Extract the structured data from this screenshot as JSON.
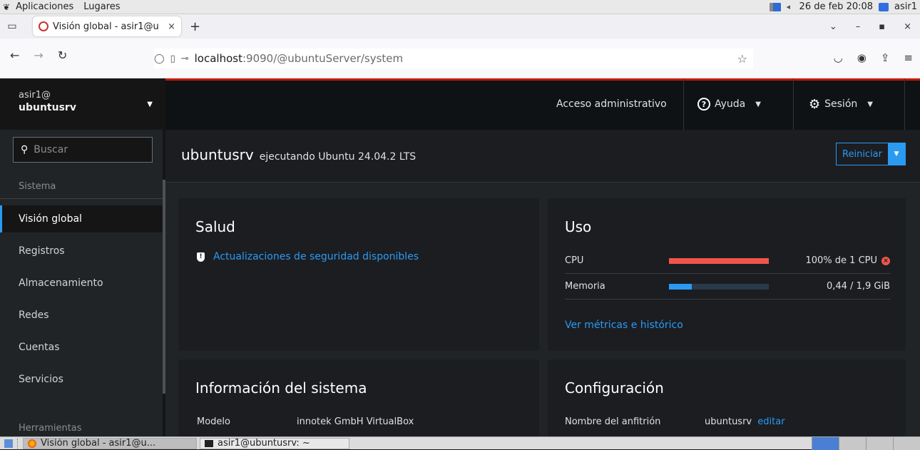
{
  "system_bar": {
    "apps_label": "Aplicaciones",
    "places_label": "Lugares",
    "clock": "26 de feb 20:08",
    "user": "asir1"
  },
  "browser": {
    "tab_title": "Visión global - asir1@u",
    "url_host": "localhost",
    "url_rest": ":9090/@ubuntuServer/system"
  },
  "cockpit": {
    "host_user": "asir1@",
    "host_name": "ubuntusrv",
    "header": {
      "admin_access": "Acceso administrativo",
      "help": "Ayuda",
      "session": "Sesión"
    },
    "sidebar": {
      "search_placeholder": "Buscar",
      "section_system": "Sistema",
      "section_tools": "Herramientas",
      "items": [
        "Visión global",
        "Registros",
        "Almacenamiento",
        "Redes",
        "Cuentas",
        "Servicios"
      ]
    },
    "page": {
      "hostname": "ubuntusrv",
      "os": "ejecutando Ubuntu 24.04.2 LTS",
      "restart": "Reiniciar"
    },
    "health": {
      "title": "Salud",
      "alert": "Actualizaciones de seguridad disponibles"
    },
    "usage": {
      "title": "Uso",
      "cpu_label": "CPU",
      "cpu_value": "100% de 1 CPU",
      "cpu_fraction": 1.0,
      "mem_label": "Memoria",
      "mem_value": "0,44 / 1,9 GiB",
      "mem_fraction": 0.23,
      "metrics_link": "Ver métricas e histórico"
    },
    "sysinfo": {
      "title": "Información del sistema",
      "model_label": "Modelo",
      "model_value": "innotek GmbH VirtualBox"
    },
    "config": {
      "title": "Configuración",
      "hostname_label": "Nombre del anfitrión",
      "hostname_value": "ubuntusrv",
      "edit": "editar"
    }
  },
  "taskbar": {
    "window1": "Visión global - asir1@u...",
    "window2": "asir1@ubuntusrv: ~"
  },
  "colors": {
    "accent": "#2b9af3",
    "danger": "#f0554b",
    "header_red": "#c9190b"
  }
}
